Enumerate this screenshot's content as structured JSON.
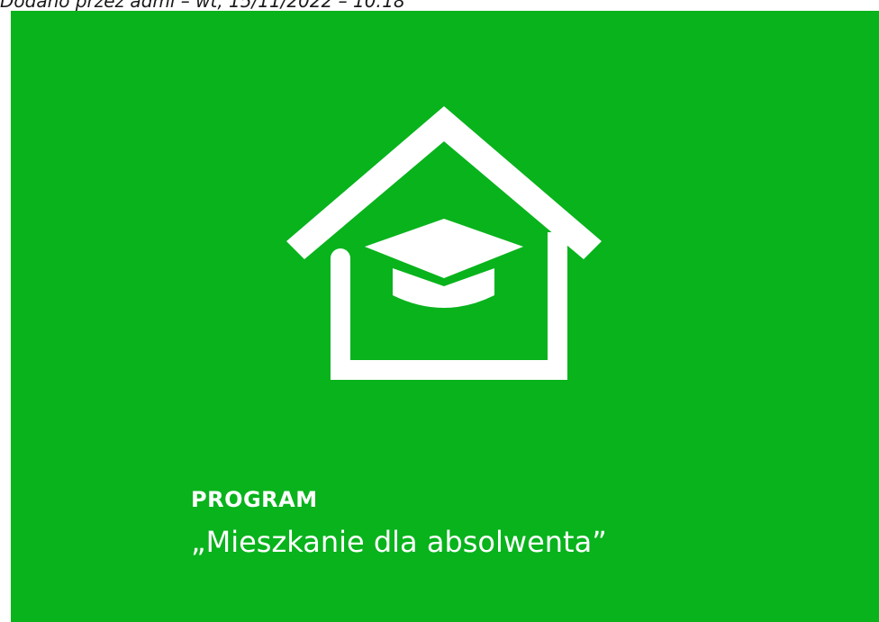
{
  "header": {
    "meta": "Dodano przez admi – wt, 15/11/2022 – 10:18"
  },
  "banner": {
    "background_color": "#08b31c",
    "logo_icon": "house-with-graduation-cap-icon",
    "kicker": "PROGRAM",
    "title": "„Mieszkanie dla absolwenta”"
  }
}
